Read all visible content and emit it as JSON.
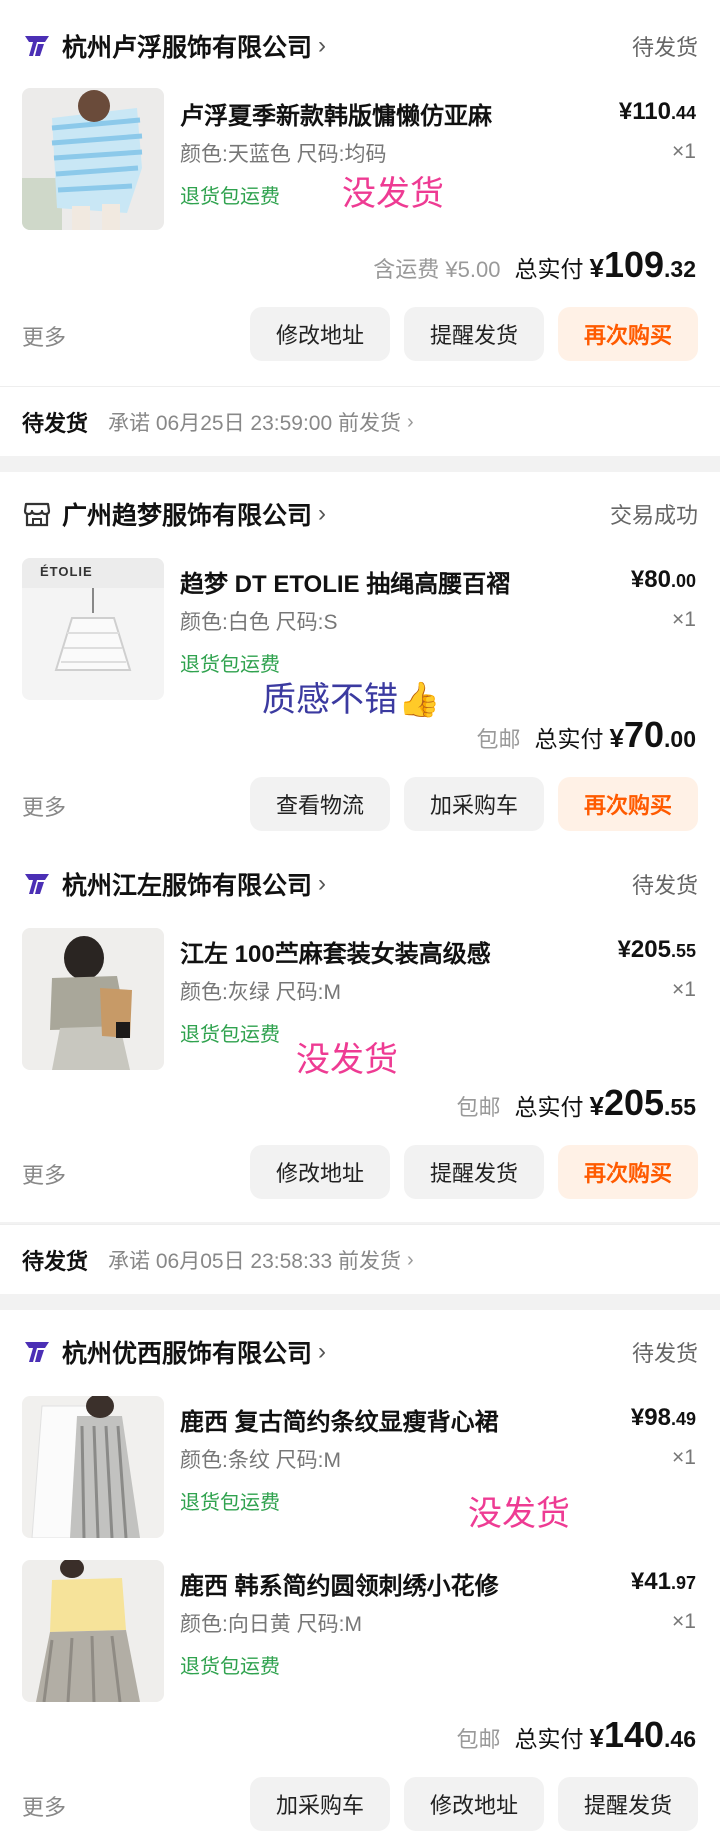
{
  "orders": [
    {
      "shop": "杭州卢浮服饰有限公司",
      "status": "待发货",
      "items": [
        {
          "title": "卢浮夏季新款韩版慵懒仿亚麻",
          "spec": "颜色:天蓝色 尺码:均码",
          "badge": "退货包运费",
          "price_int": "¥110",
          "price_dec": ".44",
          "qty": "×1"
        }
      ],
      "annotation": "没发货",
      "ship_label": "含运费 ¥5.00",
      "total_label": "总实付",
      "total_sym": "¥",
      "total_int": "109",
      "total_dec": ".32",
      "more": "更多",
      "buttons": [
        "修改地址",
        "提醒发货",
        "再次购买"
      ],
      "promise_label": "待发货",
      "promise_text": "承诺 06月25日 23:59:00 前发货"
    },
    {
      "shop": "广州趋梦服饰有限公司",
      "status": "交易成功",
      "items": [
        {
          "title": "趋梦 DT ETOLIE 抽绳高腰百褶",
          "spec": "颜色:白色 尺码:S",
          "badge": "退货包运费",
          "price_int": "¥80",
          "price_dec": ".00",
          "qty": "×1",
          "thumb_text": "ÉTOLIE"
        }
      ],
      "annotation": "质感不错👍",
      "ship_label": "包邮",
      "total_label": "总实付",
      "total_sym": "¥",
      "total_int": "70",
      "total_dec": ".00",
      "more": "更多",
      "buttons": [
        "查看物流",
        "加采购车",
        "再次购买"
      ]
    },
    {
      "shop": "杭州江左服饰有限公司",
      "status": "待发货",
      "items": [
        {
          "title": "江左 100苎麻套装女装高级感",
          "spec": "颜色:灰绿 尺码:M",
          "badge": "退货包运费",
          "price_int": "¥205",
          "price_dec": ".55",
          "qty": "×1"
        }
      ],
      "annotation": "没发货",
      "ship_label": "包邮",
      "total_label": "总实付",
      "total_sym": "¥",
      "total_int": "205",
      "total_dec": ".55",
      "more": "更多",
      "buttons": [
        "修改地址",
        "提醒发货",
        "再次购买"
      ],
      "promise_label": "待发货",
      "promise_text": "承诺 06月05日 23:58:33 前发货"
    },
    {
      "shop": "杭州优西服饰有限公司",
      "status": "待发货",
      "items": [
        {
          "title": "鹿西 复古简约条纹显瘦背心裙",
          "spec": "颜色:条纹 尺码:M",
          "badge": "退货包运费",
          "price_int": "¥98",
          "price_dec": ".49",
          "qty": "×1"
        },
        {
          "title": "鹿西 韩系简约圆领刺绣小花修",
          "spec": "颜色:向日黄 尺码:M",
          "badge": "退货包运费",
          "price_int": "¥41",
          "price_dec": ".97",
          "qty": "×1"
        }
      ],
      "annotation": "没发货",
      "ship_label": "包邮",
      "total_label": "总实付",
      "total_sym": "¥",
      "total_int": "140",
      "total_dec": ".46",
      "more": "更多",
      "buttons": [
        "加采购车",
        "修改地址",
        "提醒发货"
      ]
    }
  ],
  "colors": {
    "green_badge": "#2fa24e",
    "primary_btn_text": "#ff5a00",
    "primary_btn_bg": "#fff1e6",
    "annotation_pink": "#ee3b93",
    "annotation_blue": "#3b3aa0",
    "brand_purple": "#4b2fb5"
  },
  "icons": [
    "brand-shop-icon",
    "store-icon",
    "chevron-right-icon"
  ]
}
